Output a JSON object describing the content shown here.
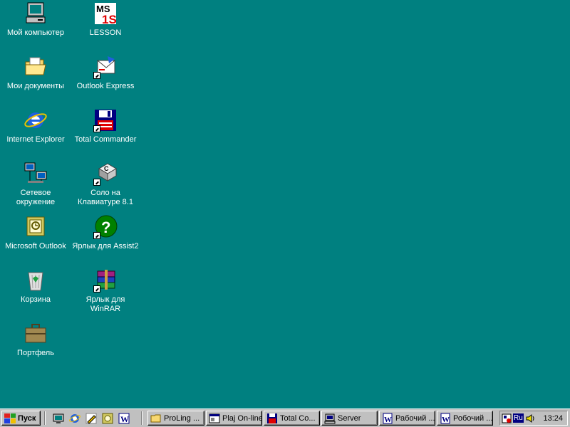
{
  "desktop": {
    "icons": [
      {
        "label": "Мой компьютер"
      },
      {
        "label": "Мои документы"
      },
      {
        "label": "Internet Explorer"
      },
      {
        "label": "Сетевое\nокружение"
      },
      {
        "label": "Microsoft Outlook"
      },
      {
        "label": "Корзина"
      },
      {
        "label": "Портфель"
      },
      {
        "label": "LESSON"
      },
      {
        "label": "Outlook Express"
      },
      {
        "label": "Total Commander"
      },
      {
        "label": "Соло на\nКлавиатуре 8.1"
      },
      {
        "label": "Ярлык для Assist2"
      },
      {
        "label": "Ярлык для\nWinRAR"
      }
    ],
    "background_color": "#008080"
  },
  "taskbar": {
    "start_label": "Пуск",
    "tasks": [
      {
        "label": "ProLing ..."
      },
      {
        "label": "Plaj On-line"
      },
      {
        "label": "Total Co..."
      },
      {
        "label": "Server"
      },
      {
        "label": "Рабочий ..."
      },
      {
        "label": "Робочий ..."
      }
    ],
    "tray": {
      "lang": "Ru",
      "clock": "13:24"
    }
  }
}
